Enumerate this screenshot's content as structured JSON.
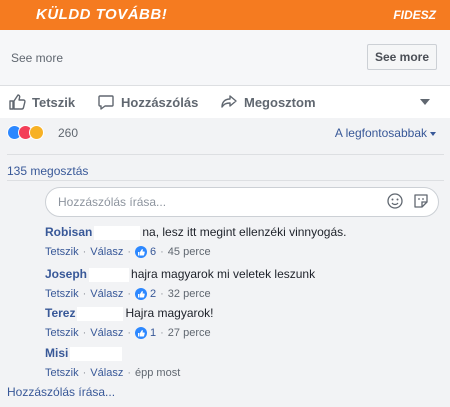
{
  "banner": {
    "left_text": "KÜLDD TOVÁBB!",
    "right_text": "FIDESZ",
    "color": "#f57b20"
  },
  "see_more": {
    "text": "See more",
    "button": "See more"
  },
  "actions": {
    "like": "Tetszik",
    "comment": "Hozzászólás",
    "share": "Megosztom"
  },
  "reactions": {
    "count": "260",
    "sort_label": "A legfontosabbak",
    "icons": [
      "like-icon",
      "love-icon",
      "haha-icon"
    ]
  },
  "shares": "135 megosztás",
  "comment_input": {
    "placeholder": "Hozzászólás írása..."
  },
  "comments": [
    {
      "author": "Robisan",
      "text": "na, lesz itt megint ellenzéki vinnyogás.",
      "like": "Tetszik",
      "reply": "Válasz",
      "likes": "6",
      "time": "45 perce"
    },
    {
      "author": "Joseph",
      "text": "hajra magyarok mi veletek leszunk",
      "like": "Tetszik",
      "reply": "Válasz",
      "likes": "2",
      "time": "32 perce"
    },
    {
      "author": "Terez",
      "text": "Hajra magyarok!",
      "like": "Tetszik",
      "reply": "Válasz",
      "likes": "1",
      "time": "27 perce"
    },
    {
      "author": "Misi",
      "text": "",
      "like": "Tetszik",
      "reply": "Válasz",
      "likes": "",
      "time": "épp most"
    }
  ],
  "bottom_input": "Hozzászólás írása..."
}
